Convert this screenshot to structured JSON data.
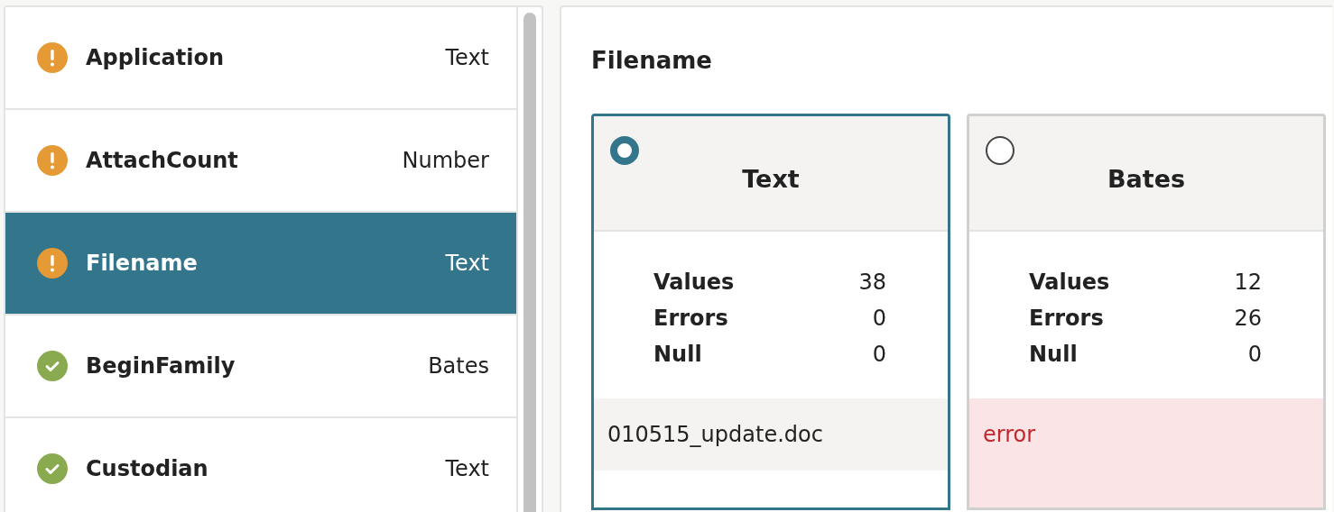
{
  "fields": [
    {
      "name": "Application",
      "type": "Text",
      "kind": "warning",
      "selected": false
    },
    {
      "name": "AttachCount",
      "type": "Number",
      "kind": "warning",
      "selected": false
    },
    {
      "name": "Filename",
      "type": "Text",
      "kind": "warning",
      "selected": true
    },
    {
      "name": "BeginFamily",
      "type": "Bates",
      "kind": "ok",
      "selected": false
    },
    {
      "name": "Custodian",
      "type": "Text",
      "kind": "ok",
      "selected": false
    }
  ],
  "detail": {
    "title": "Filename",
    "options": [
      {
        "title": "Text",
        "selected": true,
        "stats": [
          {
            "label": "Values",
            "value": "38"
          },
          {
            "label": "Errors",
            "value": "0"
          },
          {
            "label": "Null",
            "value": "0"
          }
        ],
        "samples": [
          {
            "text": "010515_update.doc",
            "error": false
          }
        ]
      },
      {
        "title": "Bates",
        "selected": false,
        "stats": [
          {
            "label": "Values",
            "value": "12"
          },
          {
            "label": "Errors",
            "value": "26"
          },
          {
            "label": "Null",
            "value": "0"
          }
        ],
        "samples": [
          {
            "text": "error",
            "error": true
          }
        ]
      }
    ]
  }
}
